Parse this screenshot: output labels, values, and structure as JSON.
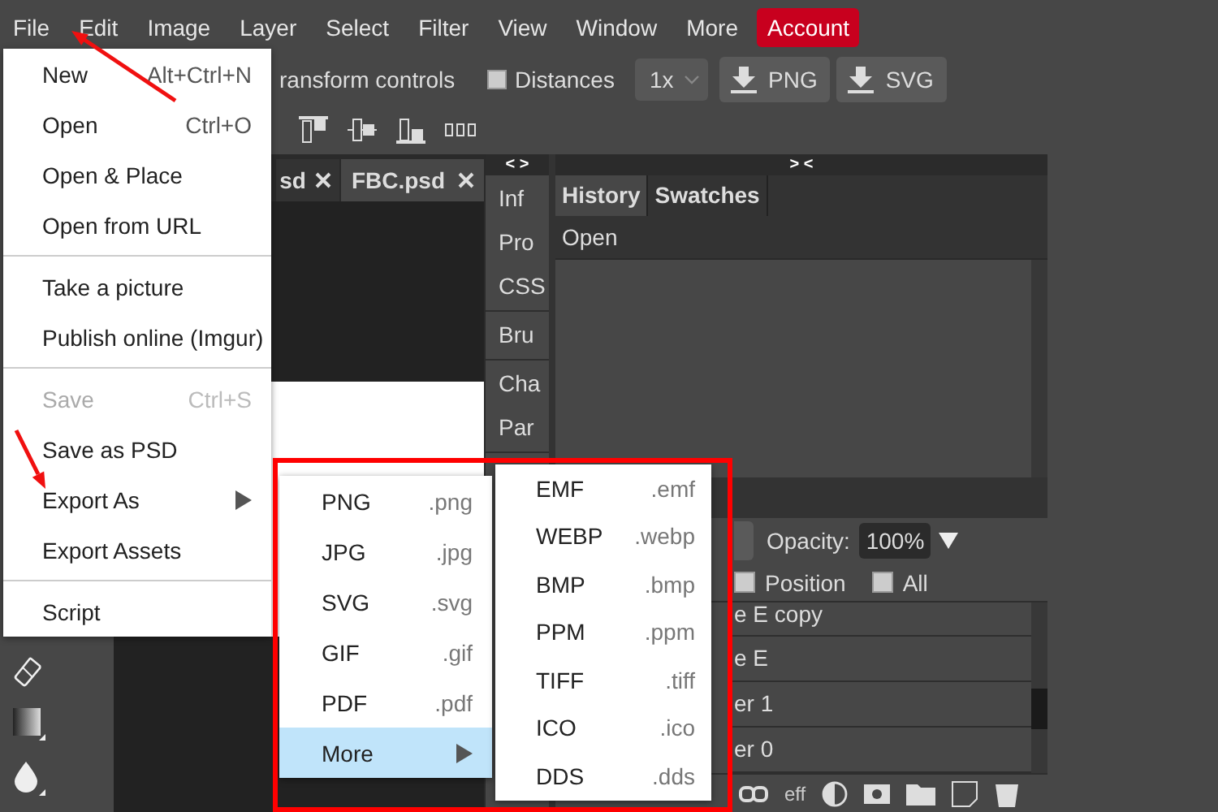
{
  "menubar": [
    {
      "label": "File",
      "kind": "menu"
    },
    {
      "label": "Edit",
      "kind": "menu"
    },
    {
      "label": "Image",
      "kind": "menu"
    },
    {
      "label": "Layer",
      "kind": "menu"
    },
    {
      "label": "Select",
      "kind": "menu"
    },
    {
      "label": "Filter",
      "kind": "menu"
    },
    {
      "label": "View",
      "kind": "menu"
    },
    {
      "label": "Window",
      "kind": "menu"
    },
    {
      "label": "More",
      "kind": "menu"
    },
    {
      "label": "Account",
      "kind": "account"
    }
  ],
  "toolbar": {
    "transform_label": "ransform controls",
    "distances": {
      "label": "Distances",
      "checked": false
    },
    "scale": "1x",
    "export_buttons": [
      "PNG",
      "SVG"
    ]
  },
  "document_tabs": [
    {
      "label": "sd",
      "selected": false
    },
    {
      "label": "FBC.psd",
      "selected": true
    }
  ],
  "panel_strip": {
    "toggle": "< >",
    "groups": [
      [
        "Inf",
        "Pro",
        "CSS"
      ],
      [
        "Bru"
      ],
      [
        "Cha",
        "Par"
      ]
    ]
  },
  "history_panel": {
    "toggle": "> <",
    "tabs": [
      {
        "label": "History",
        "selected": true
      },
      {
        "label": "Swatches",
        "selected": false
      }
    ],
    "entries": [
      "Open"
    ]
  },
  "layers_panel": {
    "opacity_label": "Opacity:",
    "opacity": "100%",
    "locks": [
      {
        "label": "Position",
        "checked": false
      },
      {
        "label": "All",
        "checked": false
      }
    ],
    "layers": [
      "e E copy",
      "e E",
      "er 1",
      "er 0"
    ],
    "effects_label": "eff"
  },
  "file_menu": [
    {
      "kind": "item",
      "label": "New",
      "shortcut": "Alt+Ctrl+N",
      "disabled": false
    },
    {
      "kind": "item",
      "label": "Open",
      "shortcut": "Ctrl+O",
      "disabled": false
    },
    {
      "kind": "item",
      "label": "Open & Place",
      "disabled": false
    },
    {
      "kind": "item",
      "label": "Open from URL",
      "disabled": false
    },
    {
      "kind": "separator"
    },
    {
      "kind": "item",
      "label": "Take a picture",
      "disabled": false
    },
    {
      "kind": "item",
      "label": "Publish online (Imgur)",
      "disabled": false
    },
    {
      "kind": "separator"
    },
    {
      "kind": "item",
      "label": "Save",
      "shortcut": "Ctrl+S",
      "disabled": true
    },
    {
      "kind": "item",
      "label": "Save as PSD",
      "disabled": false
    },
    {
      "kind": "submenu",
      "label": "Export As",
      "disabled": false
    },
    {
      "kind": "item",
      "label": "Export Assets",
      "disabled": false
    },
    {
      "kind": "separator"
    },
    {
      "kind": "item",
      "label": "Script",
      "disabled": false
    }
  ],
  "export_menu": [
    {
      "kind": "item",
      "label": "PNG",
      "extension": ".png",
      "selected": false
    },
    {
      "kind": "item",
      "label": "JPG",
      "extension": ".jpg",
      "selected": false
    },
    {
      "kind": "item",
      "label": "SVG",
      "extension": ".svg",
      "selected": false
    },
    {
      "kind": "item",
      "label": "GIF",
      "extension": ".gif",
      "selected": false
    },
    {
      "kind": "item",
      "label": "PDF",
      "extension": ".pdf",
      "selected": false
    },
    {
      "kind": "submenu",
      "label": "More",
      "selected": true
    }
  ],
  "more_menu": [
    {
      "kind": "item",
      "label": "EMF",
      "extension": ".emf"
    },
    {
      "kind": "item",
      "label": "WEBP",
      "extension": ".webp"
    },
    {
      "kind": "item",
      "label": "BMP",
      "extension": ".bmp"
    },
    {
      "kind": "item",
      "label": "PPM",
      "extension": ".ppm"
    },
    {
      "kind": "item",
      "label": "TIFF",
      "extension": ".tiff"
    },
    {
      "kind": "item",
      "label": "ICO",
      "extension": ".ico"
    },
    {
      "kind": "item",
      "label": "DDS",
      "extension": ".dds"
    }
  ]
}
